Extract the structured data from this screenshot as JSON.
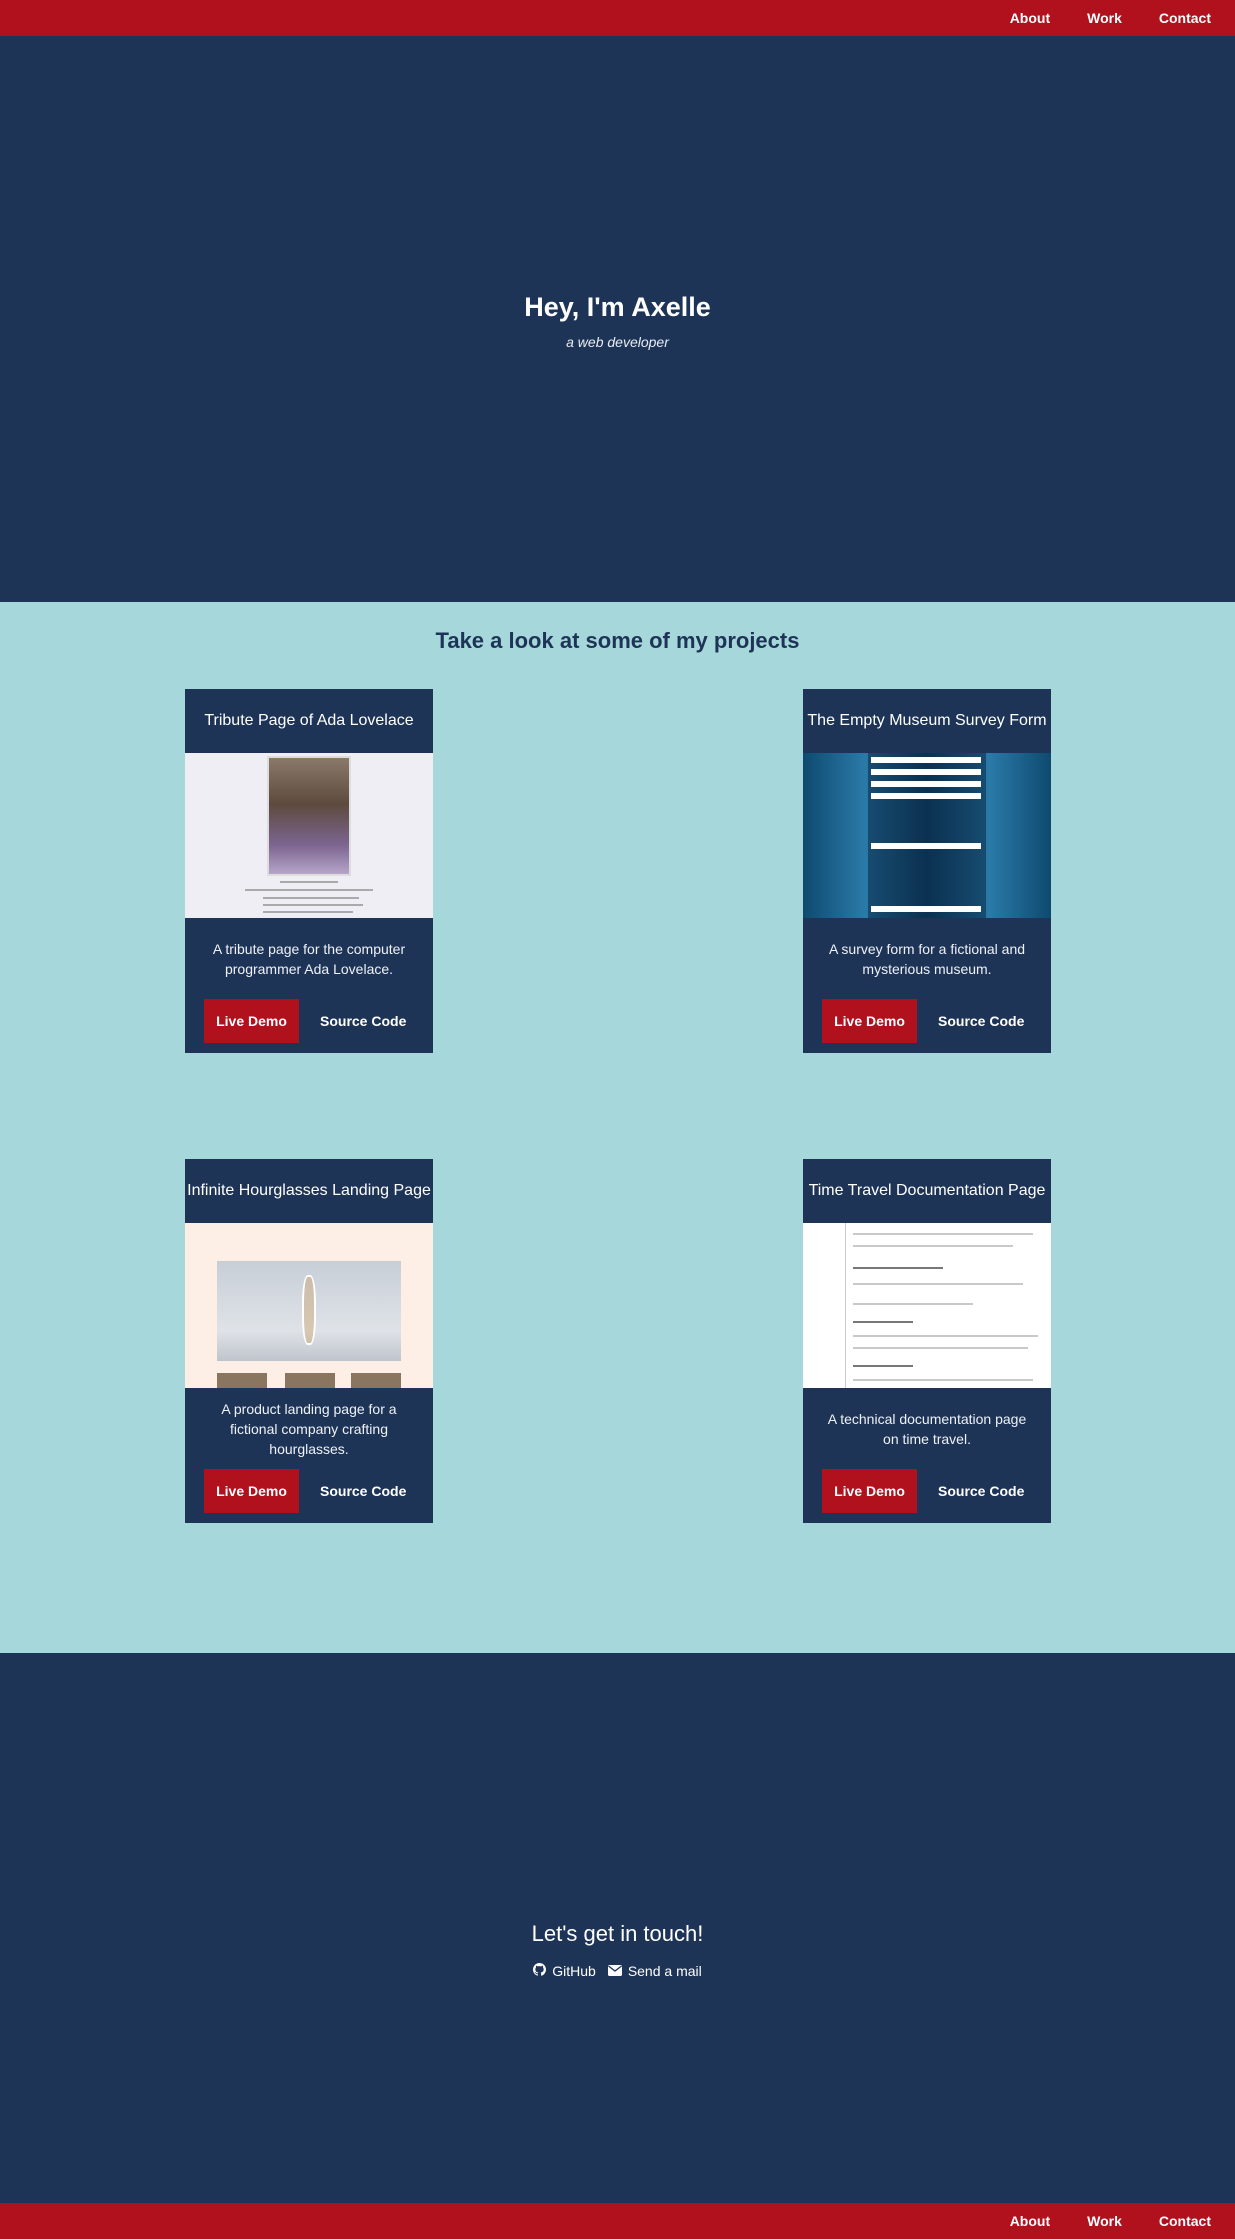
{
  "nav": {
    "about": "About",
    "work": "Work",
    "contact": "Contact"
  },
  "hero": {
    "title": "Hey, I'm Axelle",
    "subtitle": "a web developer"
  },
  "work": {
    "heading": "Take a look at some of my projects",
    "projects": [
      {
        "title": "Tribute Page of Ada Lovelace",
        "description": "A tribute page for the computer programmer Ada Lovelace.",
        "live": "Live Demo",
        "source": "Source Code"
      },
      {
        "title": "The Empty Museum Survey Form",
        "description": "A survey form for a fictional and mysterious museum.",
        "live": "Live Demo",
        "source": "Source Code"
      },
      {
        "title": "Infinite Hourglasses Landing Page",
        "description": "A product landing page for a fictional company crafting hourglasses.",
        "live": "Live Demo",
        "source": "Source Code"
      },
      {
        "title": "Time Travel Documentation Page",
        "description": "A technical documentation page on time travel.",
        "live": "Live Demo",
        "source": "Source Code"
      }
    ]
  },
  "contact": {
    "heading": "Let's get in touch!",
    "github": "GitHub",
    "mail": "Send a mail"
  },
  "colors": {
    "navy": "#1e3457",
    "red": "#b0111d",
    "teal": "#a6d8db"
  },
  "icons": {
    "github": "github-icon",
    "mail": "envelope-icon"
  }
}
